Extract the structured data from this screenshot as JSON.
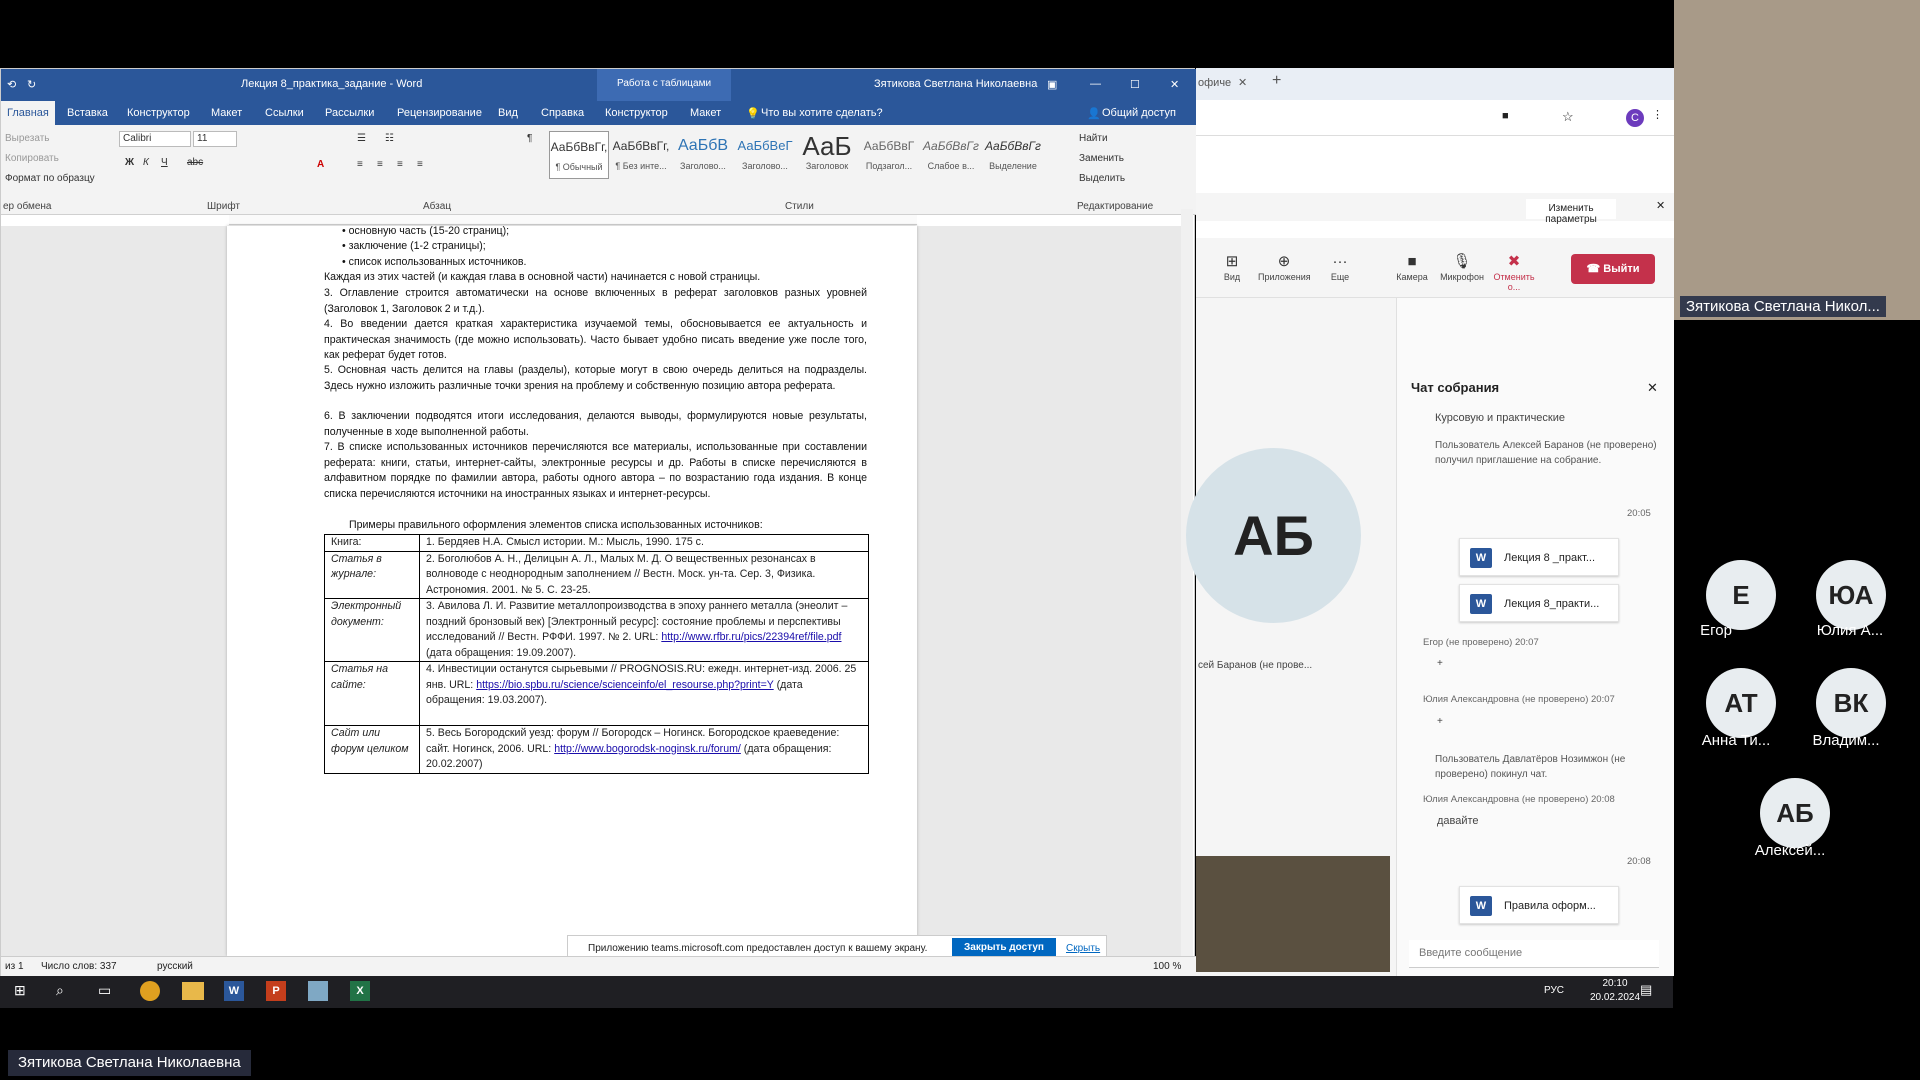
{
  "word": {
    "title": "Лекция 8_практика_задание  -  Word",
    "context_tab": "Работа с таблицами",
    "user": "Зятикова Светлана Николаевна",
    "tabs": [
      "Главная",
      "Вставка",
      "Конструктор",
      "Макет",
      "Ссылки",
      "Рассылки",
      "Рецензирование",
      "Вид",
      "Справка",
      "Конструктор",
      "Макет"
    ],
    "tell_me": "Что вы хотите сделать?",
    "share": "Общий доступ",
    "clipboard": {
      "cut": "Вырезать",
      "copy": "Копировать",
      "format": "Формат по образцу",
      "group": "ер обмена"
    },
    "font": {
      "name": "Calibri",
      "size": "11",
      "group": "Шрифт"
    },
    "paragraph_group": "Абзац",
    "styles": [
      {
        "sample": "АаБбВвГг,",
        "name": "¶ Обычный"
      },
      {
        "sample": "АаБбВвГг,",
        "name": "¶ Без инте..."
      },
      {
        "sample": "АаБбВ",
        "name": "Заголово..."
      },
      {
        "sample": "АаБбВеГ",
        "name": "Заголово..."
      },
      {
        "sample": "АаБ",
        "name": "Заголовок"
      },
      {
        "sample": "АаБбВвГ",
        "name": "Подзагол..."
      },
      {
        "sample": "АаБбВвГг",
        "name": "Слабое в..."
      },
      {
        "sample": "АаБбВвГг",
        "name": "Выделение"
      }
    ],
    "styles_group": "Стили",
    "editing": {
      "find": "Найти",
      "replace": "Заменить",
      "select": "Выделить",
      "group": "Редактирование"
    },
    "paragraphs": [
      "основную часть (15-20 страниц);",
      "заключение (1-2 страницы);",
      "список использованных источников.",
      "Каждая из этих частей (и каждая глава в основной части) начинается с новой страницы.",
      "3. Оглавление строится автоматически на основе включенных в реферат заголовков разных уровней (Заголовок 1, Заголовок 2 и т.д.).",
      "4. Во введении дается краткая характеристика изучаемой темы, обосновывается ее актуальность и практическая значимость (где можно использовать). Часто бывает удобно писать введение уже после того, как реферат будет готов.",
      "5. Основная часть делится на главы (разделы), которые могут в свою очередь делиться на подразделы. Здесь нужно изложить различные точки зрения на проблему и собственную позицию автора реферата.",
      "6. В заключении подводятся итоги исследования, делаются выводы, формулируются новые результаты, полученные в ходе выполненной работы.",
      "7. В списке использованных источников перечисляются все материалы, использованные при составлении реферата: книги, статьи, интернет-сайты, электронные ресурсы и др. Работы в списке перечисляются в алфавитном порядке по фамилии автора, работы одного автора – по возрастанию года издания. В конце списка перечисляются источники на иностранных языках и интернет-ресурсы.",
      "Примеры правильного оформления элементов списка использованных источников:"
    ],
    "table": [
      {
        "k": "Книга:",
        "v": "1.    Бердяев Н.А. Смысл истории. М.: Мысль, 1990. 175 с.",
        "link": "",
        "tail": ""
      },
      {
        "k": "Статья в журнале:",
        "v": "2.          Боголюбов А. Н., Делицын А. Л., Малых М. Д. О вещественных резонансах в волноводе с неоднородным заполнением // Вестн. Моск. ун-та. Сер. 3, Физика. Астрономия. 2001. № 5. С. 23-25.",
        "link": "",
        "tail": ""
      },
      {
        "k": "Электронный документ:",
        "v": "3.          Авилова Л. И. Развитие металлопроизводства в эпоху раннего металла (энеолит – поздний бронзовый век) [Электронный ресурс]: состояние проблемы и перспективы исследований // Вестн. РФФИ. 1997. № 2. URL: ",
        "link": "http://www.rfbr.ru/pics/22394ref/file.pdf",
        "tail": " (дата обращения: 19.09.2007)."
      },
      {
        "k": "Статья на сайте:",
        "v": "4.          Инвестиции останутся сырьевыми // PROGNOSIS.RU: ежедн. интернет-изд. 2006. 25 янв. URL: ",
        "link": "https://bio.spbu.ru/science/scienceinfo/el_resourse.php?print=Y",
        "tail": " (дата обращения: 19.03.2007)."
      },
      {
        "k": "Сайт или форум целиком",
        "v": "5.          Весь Богородский уезд: форум // Богородск – Ногинск. Богородское краеведение: сайт. Ногинск, 2006. URL: ",
        "link": "http://www.bogorodsk-noginsk.ru/forum/",
        "tail": " (дата обращения: 20.02.2007)"
      }
    ],
    "status": {
      "page": "из 1",
      "words": "Число слов: 337",
      "lang": "русский",
      "zoom": "100 %"
    },
    "share_notice": "Приложению teams.microsoft.com предоставлен доступ к вашему экрану.",
    "stop_share": "Закрыть доступ",
    "hide": "Скрыть"
  },
  "teams": {
    "tab_title": "офиче",
    "change_settings": "Изменить параметры",
    "toolbar": [
      {
        "icon": "grid-icon",
        "label": "Вид"
      },
      {
        "icon": "apps-icon",
        "label": "Приложения"
      },
      {
        "icon": "more-icon",
        "label": "Еще"
      },
      {
        "icon": "camera-icon",
        "label": "Камера"
      },
      {
        "icon": "mic-icon",
        "label": "Микрофон"
      },
      {
        "icon": "stop-share-icon",
        "label": "Отменить о..."
      }
    ],
    "leave": "Выйти",
    "stage_avatar": "АБ",
    "stage_name": "сей Баранов (не прове...",
    "chat_title": "Чат собрания",
    "messages": {
      "m1": "Курсовую и практические",
      "m2": "Пользователь Алексей Баранов (не проверено) получил приглашение на собрание.",
      "t1": "20:05",
      "file1": "Лекция 8 _практ...",
      "file2": "Лекция 8_практи...",
      "m3_meta": "Егор (не проверено)  20:07",
      "m3": "+",
      "m4_meta": "Юлия Александровна (не проверено)  20:07",
      "m4": "+",
      "m5": "Пользователь Давлатёров Нозимжон (не проверено) покинул чат.",
      "m6_meta": "Юлия Александровна (не проверено)  20:08",
      "m6": "давайте",
      "t2": "20:08",
      "file3": "Правила оформ..."
    },
    "compose_placeholder": "Введите сообщение"
  },
  "presenter_label": "Зятикова Светлана Никол...",
  "participants": [
    {
      "initials": "Е",
      "name": "Егор"
    },
    {
      "initials": "ЮА",
      "name": "Юлия А..."
    },
    {
      "initials": "АТ",
      "name": "Анна Ти..."
    },
    {
      "initials": "ВК",
      "name": "Владим..."
    },
    {
      "initials": "АБ",
      "name": "Алексей..."
    }
  ],
  "taskbar": {
    "lang": "РУС",
    "time": "20:10",
    "date": "20.02.2024"
  },
  "bottom_name": "Зятикова Светлана Николаевна"
}
